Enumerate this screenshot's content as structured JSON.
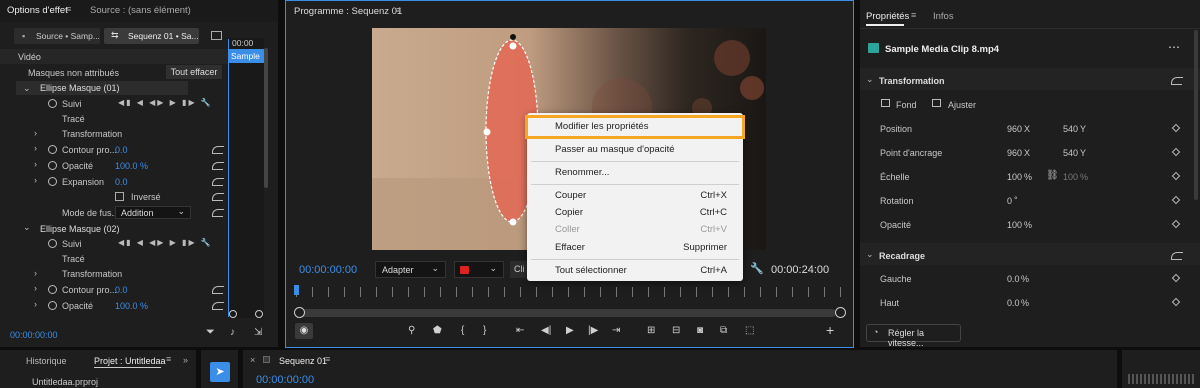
{
  "left_panel": {
    "tab_effects": "Options d'effet",
    "tab_source": "Source : (sans élément)",
    "subtab_source": "Source • Samp...",
    "subtab_seq": "Sequenz 01 • Sa...",
    "timeline_time": "00:00",
    "clip_label": "Sample I",
    "section_video": "Vidéo",
    "unattributed": "Masques non attribués",
    "clear_all": "Tout effacer",
    "mask1": "Ellipse Masque (01)",
    "suivi": "Suivi",
    "trace": "Tracé",
    "transformation": "Transformation",
    "contour": "Contour pro...",
    "contour_val": "0.0",
    "opacite": "Opacité",
    "opacite_val": "100.0 %",
    "expansion": "Expansion",
    "expansion_val": "0.0",
    "inverse": "Inversé",
    "mode": "Mode de fus...",
    "mode_val": "Addition",
    "mask2": "Ellipse Masque (02)",
    "bottom_time": "00:00:00:00"
  },
  "program": {
    "title": "Programme : Sequenz 01",
    "time_left": "00:00:00:00",
    "fit": "Adapter",
    "time_right": "00:00:24:00",
    "clip_btn": "Cli"
  },
  "context_menu": {
    "items": [
      {
        "label": "Modifier les propriétés",
        "shortcut": ""
      },
      {
        "label": "Passer au masque d'opacité",
        "shortcut": ""
      },
      {
        "label": "Renommer...",
        "shortcut": ""
      },
      {
        "label": "Couper",
        "shortcut": "Ctrl+X"
      },
      {
        "label": "Copier",
        "shortcut": "Ctrl+C"
      },
      {
        "label": "Coller",
        "shortcut": "Ctrl+V"
      },
      {
        "label": "Effacer",
        "shortcut": "Supprimer"
      },
      {
        "label": "Tout sélectionner",
        "shortcut": "Ctrl+A"
      }
    ]
  },
  "properties": {
    "tab_props": "Propriétés",
    "tab_info": "Infos",
    "clip_name": "Sample Media Clip 8.mp4",
    "transformation": "Transformation",
    "fond": "Fond",
    "ajuster": "Ajuster",
    "position": "Position",
    "pos_x": "960",
    "pos_y": "540",
    "ancrage": "Point d'ancrage",
    "anc_x": "960",
    "anc_y": "540",
    "echelle": "Échelle",
    "ech_val": "100",
    "ech_val2": "100",
    "pct": "%",
    "rotation": "Rotation",
    "rot_val": "0",
    "deg": "°",
    "opacite": "Opacité",
    "op_val": "100",
    "recadrage": "Recadrage",
    "gauche": "Gauche",
    "gauche_val": "0.0",
    "haut": "Haut",
    "haut_val": "0.0",
    "speed_btn": "Régler la vitesse...",
    "x": "X",
    "y": "Y"
  },
  "bottom": {
    "tab_hist": "Historique",
    "tab_proj": "Projet : Untitledaa",
    "proj_file": "Untitledaa.prproj",
    "seq_tab": "Sequenz 01",
    "seq_time": "00:00:00:00"
  },
  "colors": {
    "accent": "#3b8ee8",
    "highlight_border": "#f5a623",
    "mask": "#e8614f"
  }
}
